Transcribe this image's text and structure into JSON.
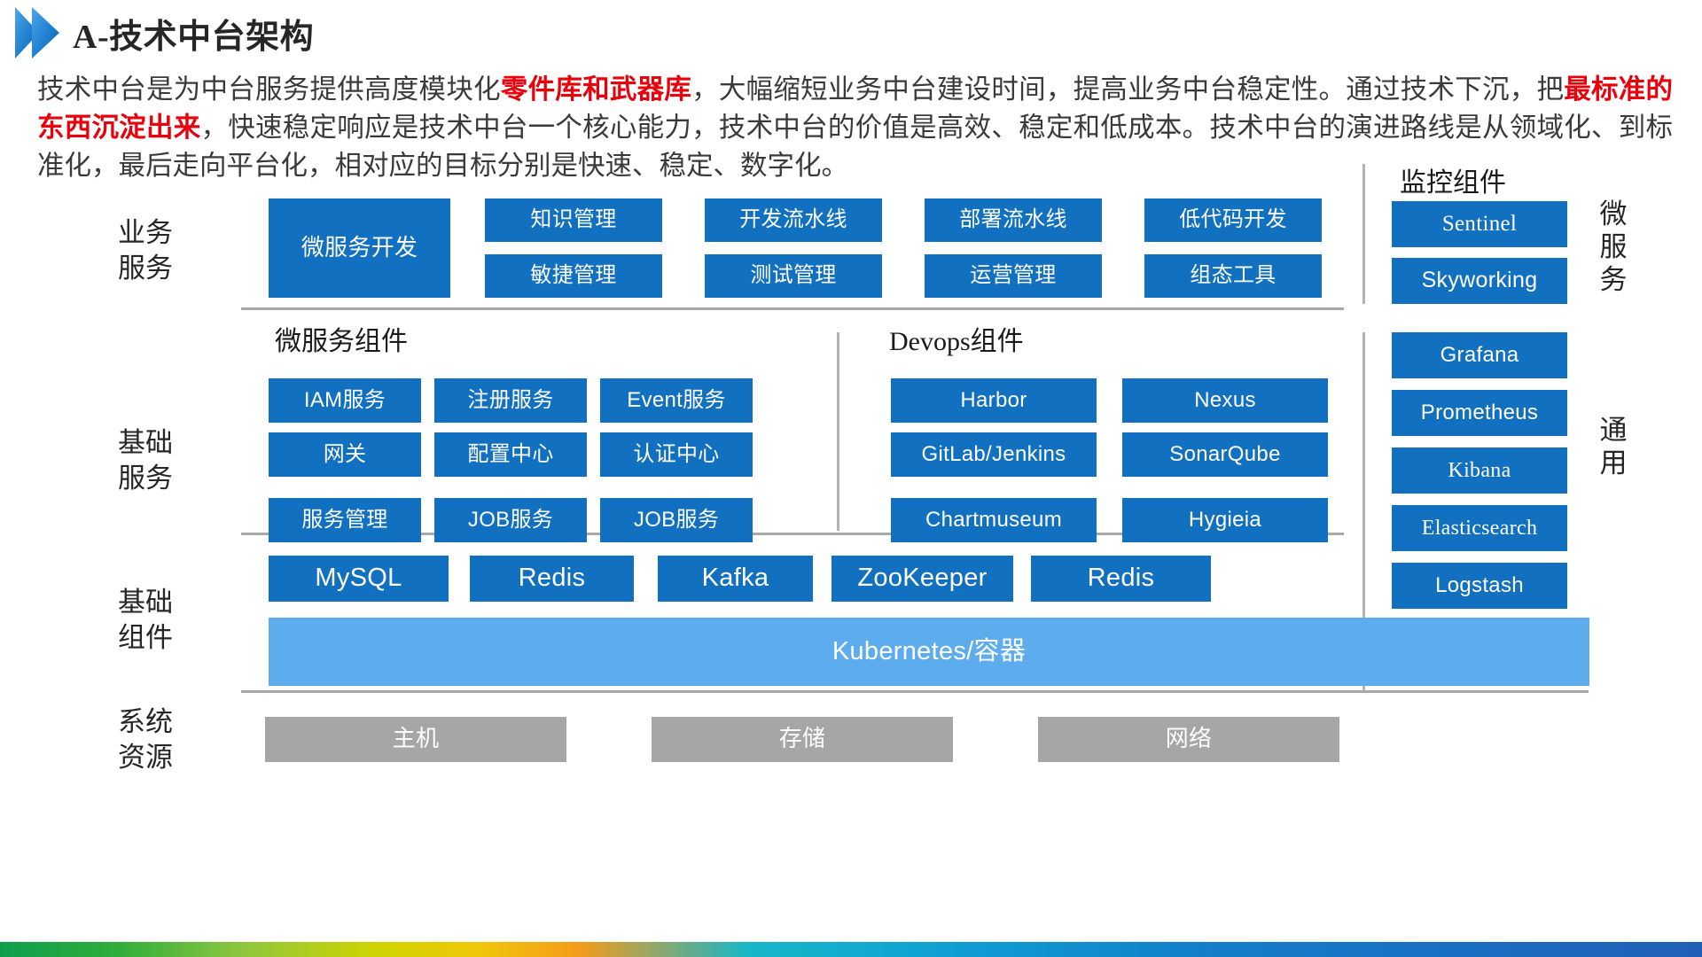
{
  "slide": {
    "title": "A-技术中台架构",
    "paragraph": [
      {
        "t": "技术中台是为中台服务提供高度模块化",
        "em": false
      },
      {
        "t": "零件库和武器库",
        "em": true
      },
      {
        "t": "，大幅缩短业务中台建设时间，提高业务中台稳定性。通过技术下沉，把",
        "em": false
      },
      {
        "t": "最标准的东西沉淀出来",
        "em": true
      },
      {
        "t": "，快速稳定响应是技术中台一个核心能力，技术中台的价值是高效、稳定和低成本。技术中台的演进路线是从领域化、到标准化，最后走向平台化，相对应的目标分别是快速、稳定、数字化。",
        "em": false
      }
    ]
  },
  "diagram": {
    "row_labels": {
      "business": "业务\n服务",
      "base_service": "基础\n服务",
      "base_component": "基础\n组件",
      "system_resource": "系统\n资源"
    },
    "side_labels": {
      "microservice": "微\n服\n务",
      "general": "通\n用"
    },
    "section_titles": {
      "monitor": "监控组件",
      "microservice_components": "微服务组件",
      "devops_components": "Devops组件"
    },
    "business": {
      "feature_box": "微服务开发",
      "columns": [
        {
          "top": "知识管理",
          "bottom": "敏捷管理"
        },
        {
          "top": "开发流水线",
          "bottom": "测试管理"
        },
        {
          "top": "部署流水线",
          "bottom": "运营管理"
        },
        {
          "top": "低代码开发",
          "bottom": "组态工具"
        }
      ]
    },
    "monitor_boxes": [
      "Sentinel",
      "Skyworking"
    ],
    "microservice_grid": [
      [
        "IAM服务",
        "注册服务",
        "Event服务"
      ],
      [
        "网关",
        "配置中心",
        "认证中心"
      ],
      [
        "服务管理",
        "JOB服务",
        "JOB服务"
      ]
    ],
    "devops_grid": [
      [
        "Harbor",
        "Nexus"
      ],
      [
        "GitLab/Jenkins",
        "SonarQube"
      ],
      [
        "Chartmuseum",
        "Hygieia"
      ]
    ],
    "general_boxes": [
      "Grafana",
      "Prometheus",
      "Kibana",
      "Elasticsearch",
      "Logstash"
    ],
    "base_components": [
      "MySQL",
      "Redis",
      "Kafka",
      "ZooKeeper",
      "Redis"
    ],
    "platform_bar": "Kubernetes/容器",
    "system_resources": [
      "主机",
      "存储",
      "网络"
    ]
  },
  "colors": {
    "box_blue": "#1270c1",
    "platform_blue": "#5cacee",
    "resource_grey": "#a6a6a6",
    "accent_red": "#e8000b",
    "rule_grey": "#a8a8a8"
  }
}
